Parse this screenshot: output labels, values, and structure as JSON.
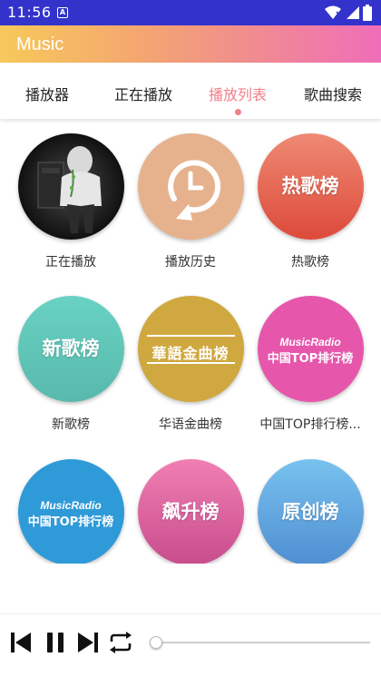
{
  "status_bar": {
    "time": "11:56",
    "notification_letter": "A"
  },
  "app_bar": {
    "title": "Music"
  },
  "tabs": [
    {
      "label": "播放器",
      "active": false
    },
    {
      "label": "正在播放",
      "active": false
    },
    {
      "label": "播放列表",
      "active": true
    },
    {
      "label": "歌曲搜索",
      "active": false
    }
  ],
  "playlists": [
    {
      "label": "正在播放",
      "cover": "hooded-figure-photo"
    },
    {
      "label": "播放历史",
      "cover": "history-clock-icon"
    },
    {
      "label": "热歌榜",
      "cover_text": "热歌榜"
    },
    {
      "label": "新歌榜",
      "cover_text": "新歌榜"
    },
    {
      "label": "华语金曲榜",
      "cover_text": "華語金曲榜"
    },
    {
      "label": "中国TOP排行榜...",
      "cover_brand": "MusicRadio",
      "cover_text": "中国TOP排行榜"
    },
    {
      "label": "",
      "cover_brand": "MusicRadio",
      "cover_text": "中国TOP排行榜"
    },
    {
      "label": "",
      "cover_text": "飙升榜"
    },
    {
      "label": "",
      "cover_text": "原创榜"
    }
  ],
  "colors": {
    "status_bar": "#3333cc",
    "accent": "#f07f8a",
    "gradient_start": "#f7c95a",
    "gradient_end": "#ef6db9"
  },
  "player": {
    "icons": [
      "skip-previous-icon",
      "pause-icon",
      "skip-next-icon",
      "repeat-icon"
    ],
    "progress": 0.02
  }
}
